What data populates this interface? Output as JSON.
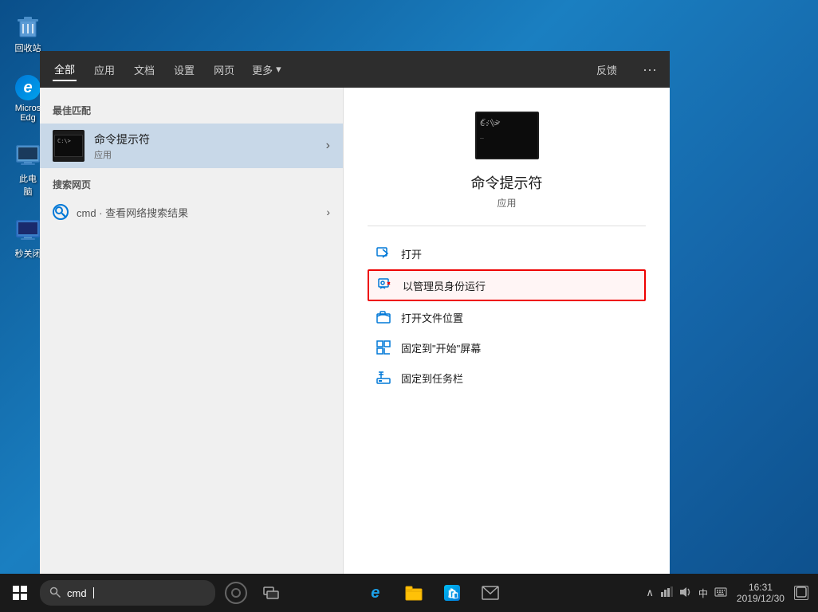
{
  "desktop": {
    "background_color": "#1a6ba0"
  },
  "desktop_icons": [
    {
      "id": "recycle-bin",
      "label": "回收站",
      "icon_type": "recycle"
    },
    {
      "id": "edge",
      "label": "Micros\nEdg",
      "icon_type": "edge"
    },
    {
      "id": "computer",
      "label": "此电\n脑",
      "icon_type": "computer"
    },
    {
      "id": "shortcut",
      "label": "秒关闭",
      "icon_type": "shortcut"
    }
  ],
  "filter_bar": {
    "tabs": [
      {
        "id": "all",
        "label": "全部",
        "active": true
      },
      {
        "id": "apps",
        "label": "应用",
        "active": false
      },
      {
        "id": "docs",
        "label": "文档",
        "active": false
      },
      {
        "id": "settings",
        "label": "设置",
        "active": false
      },
      {
        "id": "web",
        "label": "网页",
        "active": false
      },
      {
        "id": "more",
        "label": "更多",
        "active": false
      }
    ],
    "feedback_label": "反馈",
    "dots_label": "···"
  },
  "best_match": {
    "section_label": "最佳匹配",
    "item_name": "命令提示符",
    "item_type": "应用"
  },
  "web_section": {
    "section_label": "搜索网页",
    "item_query": "cmd",
    "item_description": " · 查看网络搜索结果"
  },
  "app_detail": {
    "title": "命令提示符",
    "subtitle": "应用",
    "actions": [
      {
        "id": "open",
        "label": "打开",
        "highlighted": false
      },
      {
        "id": "run-admin",
        "label": "以管理员身份运行",
        "highlighted": true
      },
      {
        "id": "open-location",
        "label": "打开文件位置",
        "highlighted": false
      },
      {
        "id": "pin-start",
        "label": "固定到\"开始\"屏幕",
        "highlighted": false
      },
      {
        "id": "pin-taskbar",
        "label": "固定到任务栏",
        "highlighted": false
      }
    ]
  },
  "taskbar": {
    "search_placeholder": "cmd",
    "search_icon": "search",
    "start_icon": "⊞",
    "cortana_label": "",
    "taskview_label": "",
    "edge_label": "e",
    "explorer_label": "📁",
    "store_label": "🛍",
    "mail_label": "✉",
    "tray": {
      "chevron": "∧",
      "network": "🌐",
      "volume": "🔊",
      "ime": "中",
      "keyboard": "⌨",
      "time": "16:31",
      "date": "2019/12/30",
      "notification": "🔔"
    }
  }
}
